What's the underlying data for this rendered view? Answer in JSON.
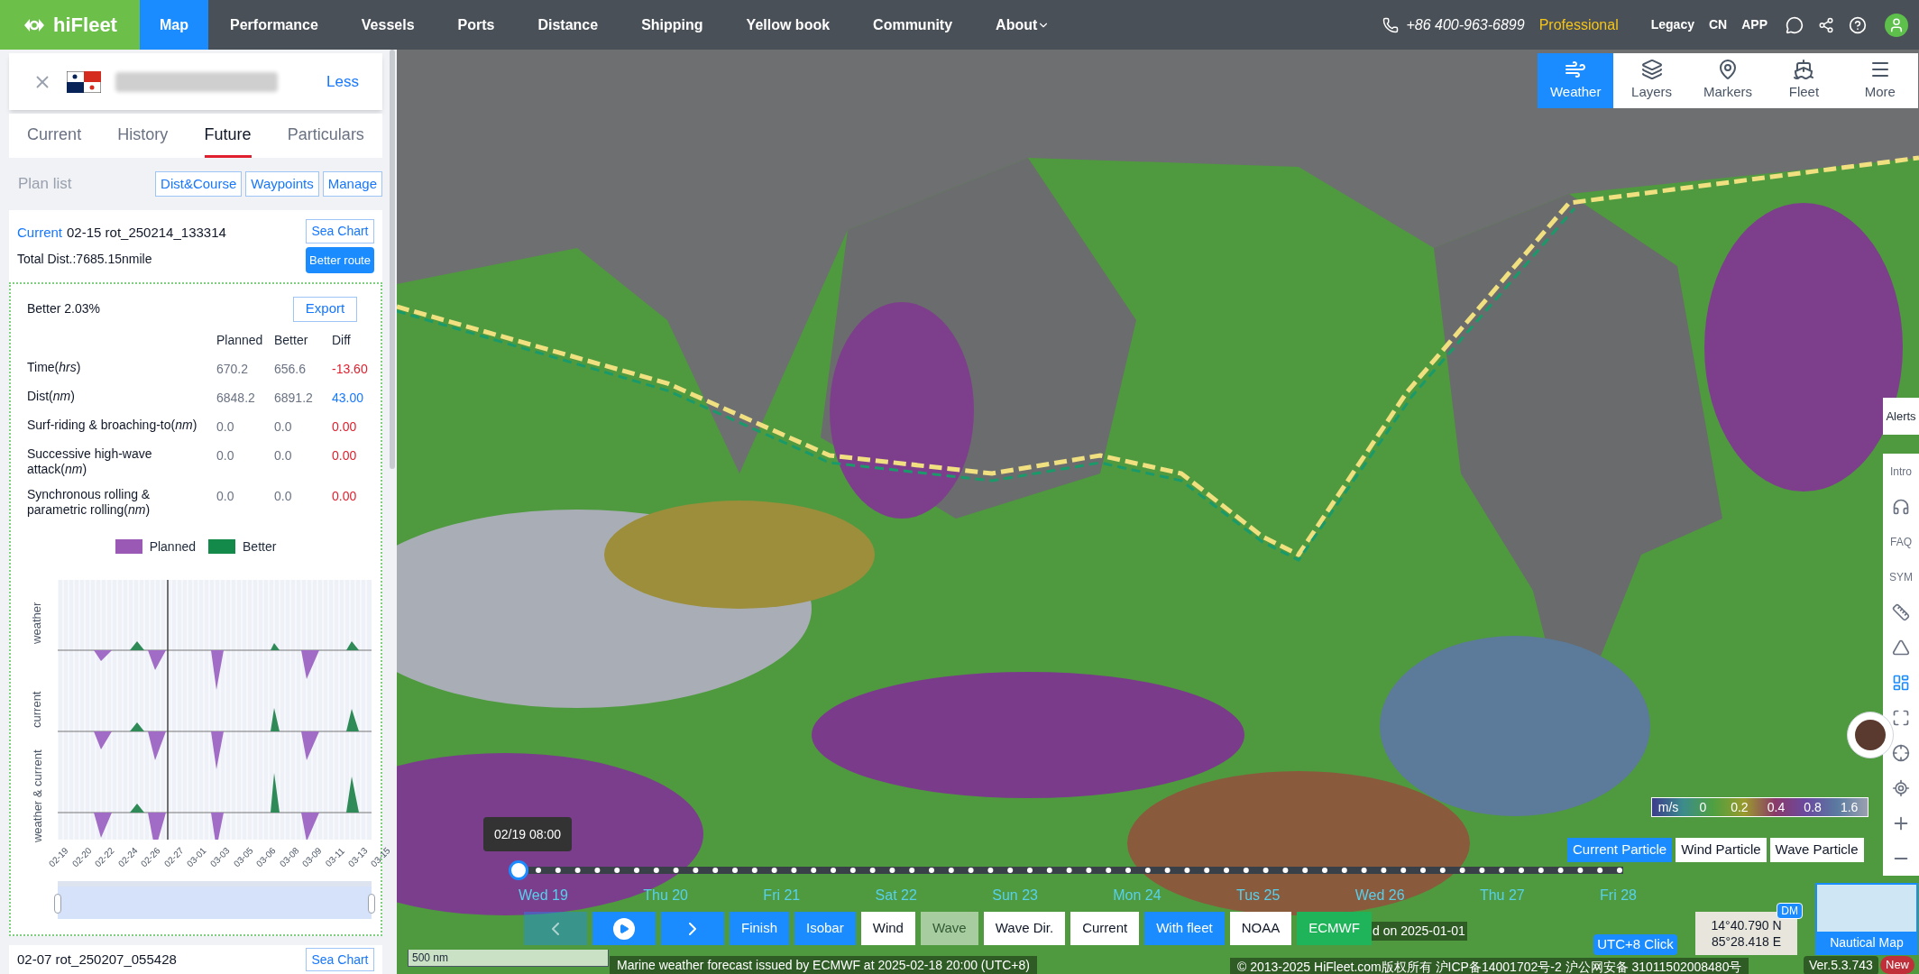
{
  "nav": {
    "logo": "hiFleet",
    "items": [
      {
        "label": "Map",
        "selected": true,
        "dropdown": false
      },
      {
        "label": "Performance",
        "selected": false,
        "dropdown": false
      },
      {
        "label": "Vessels",
        "selected": false,
        "dropdown": false
      },
      {
        "label": "Ports",
        "selected": false,
        "dropdown": false
      },
      {
        "label": "Distance",
        "selected": false,
        "dropdown": false
      },
      {
        "label": "Shipping",
        "selected": false,
        "dropdown": false
      },
      {
        "label": "Yellow book",
        "selected": false,
        "dropdown": false
      },
      {
        "label": "Community",
        "selected": false,
        "dropdown": false
      },
      {
        "label": "About",
        "selected": false,
        "dropdown": true
      }
    ],
    "phone": "+86 400-963-6899",
    "plan": "Professional",
    "links": [
      "Legacy",
      "CN",
      "APP"
    ]
  },
  "vessel_card": {
    "action": "Less"
  },
  "tabs": [
    {
      "label": "Current",
      "selected": false
    },
    {
      "label": "History",
      "selected": false
    },
    {
      "label": "Future",
      "selected": true
    },
    {
      "label": "Particulars",
      "selected": false
    }
  ],
  "plan_list": {
    "title": "Plan list",
    "buttons": [
      "Dist&Course",
      "Waypoints",
      "Manage"
    ]
  },
  "current_plan": {
    "status": "Current",
    "name": "02-15 rot_250214_133314",
    "total": "Total Dist.:7685.15nmile",
    "sea_chart": "Sea Chart",
    "better_route": "Better route"
  },
  "comparison": {
    "title": "Better 2.03%",
    "export": "Export",
    "columns": [
      "Planned",
      "Better",
      "Diff"
    ],
    "rows": [
      {
        "label": "Time(*hrs*)",
        "planned": "670.2",
        "better": "656.6",
        "diff": "-13.60",
        "color": "#e0202e"
      },
      {
        "label": "Dist(*nm*)",
        "planned": "6848.2",
        "better": "6891.2",
        "diff": "43.00",
        "color": "#1677ff"
      },
      {
        "label": "Surf-riding & broaching-to(*nm*)",
        "planned": "0.0",
        "better": "0.0",
        "diff": "0.00",
        "color": "#e0202e"
      },
      {
        "label": "Successive high-wave attack(*nm*)",
        "planned": "0.0",
        "better": "0.0",
        "diff": "0.00",
        "color": "#e0202e"
      },
      {
        "label": "Synchronous rolling & parametric rolling(*nm*)",
        "planned": "0.0",
        "better": "0.0",
        "diff": "0.00",
        "color": "#e0202e"
      }
    ]
  },
  "chart": {
    "legend": [
      {
        "label": "Planned",
        "color": "#9b59b6"
      },
      {
        "label": "Better",
        "color": "#138a4a"
      }
    ],
    "panels": [
      "weather",
      "current",
      "weather & current"
    ],
    "zoom": {
      "level": 1
    },
    "x_labels": [
      "02-19",
      "02-20",
      "02-22",
      "02-24",
      "02-26",
      "02-27",
      "03-01",
      "03-03",
      "03-05",
      "03-06",
      "03-08",
      "03-09",
      "03-11",
      "03-13",
      "03-15"
    ]
  },
  "next_plan": {
    "name": "02-07 rot_250207_055428",
    "sea_chart": "Sea Chart"
  },
  "map_toolbar": [
    {
      "label": "Weather",
      "selected": true
    },
    {
      "label": "Layers",
      "selected": false
    },
    {
      "label": "Markers",
      "selected": false
    },
    {
      "label": "Fleet",
      "selected": false
    },
    {
      "label": "More",
      "selected": false
    }
  ],
  "side_tools": {
    "alerts": "Alerts",
    "texts": [
      "Intro",
      "FAQ",
      "SYM"
    ]
  },
  "legend": {
    "unit": "m/s",
    "ticks": [
      "0",
      "0.2",
      "0.4",
      "0.8",
      "1.6"
    ]
  },
  "particles": [
    {
      "label": "Current Particle",
      "selected": true
    },
    {
      "label": "Wind Particle",
      "selected": false
    },
    {
      "label": "Wave Particle",
      "selected": false
    }
  ],
  "timeline": {
    "tooltip": "02/19 08:00",
    "days": [
      "Wed 19",
      "Thu 20",
      "Fri 21",
      "Sat 22",
      "Sun 23",
      "Mon 24",
      "Tus 25",
      "Wed 26",
      "Thu 27",
      "Fri 28"
    ],
    "prev_disabled": true,
    "buttons": [
      {
        "label": "Finish",
        "selected": true,
        "disabled": false
      },
      {
        "label": "Isobar",
        "selected": true,
        "disabled": false
      },
      {
        "label": "Wind",
        "selected": false,
        "disabled": false
      },
      {
        "label": "Wave",
        "selected": false,
        "disabled": true
      },
      {
        "label": "Wave Dir.",
        "selected": false,
        "disabled": false
      },
      {
        "label": "Current",
        "selected": false,
        "disabled": false
      },
      {
        "label": "With fleet",
        "selected": true,
        "disabled": false
      }
    ],
    "sources": [
      {
        "label": "NOAA",
        "selected": false
      },
      {
        "label": "ECMWF",
        "selected": true
      }
    ],
    "hidden_note": "d on 2025-01-01"
  },
  "scale": "500 nm",
  "forecast_note": "Marine weather forecast issued by ECMWF at 2025-02-18 20:00 (UTC+8)",
  "copyright": "© 2013-2025 HiFleet.com版权所有 沪ICP备14001702号-2 沪公网安备 31011502008480号",
  "version": "Ver.5.3.743",
  "badge": "New",
  "utc": "UTC+8 Click",
  "coords": {
    "lat": "14°40.790 N",
    "lon": "85°28.418 E",
    "format": "DM"
  },
  "nautical_map": "Nautical Map"
}
